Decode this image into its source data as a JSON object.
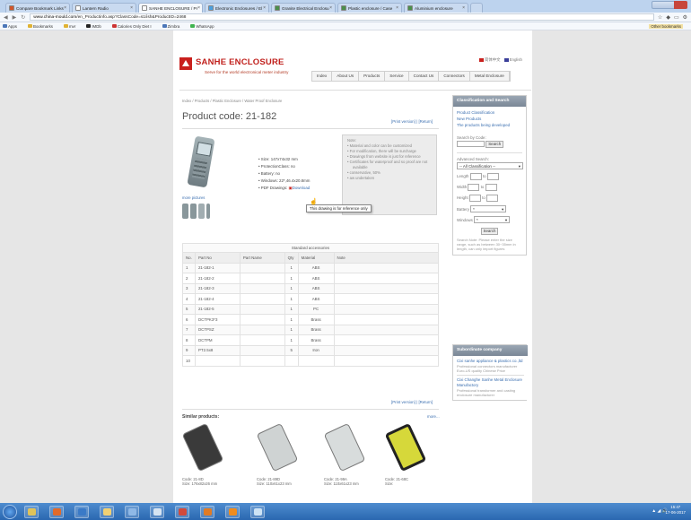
{
  "browser": {
    "tabs": [
      {
        "label": "Compare Bookmark Links",
        "color": "#d1552c"
      },
      {
        "label": "Lantern Radio",
        "color": "#ffffff"
      },
      {
        "label": "SANHE ENCLOSURE / Pr",
        "color": "#ffffff",
        "active": true
      },
      {
        "label": "Electronic Enclosures / El",
        "color": "#4aa0e0"
      },
      {
        "label": "Granite Electrical Enclosu",
        "color": "#4b8f4b"
      },
      {
        "label": "Plastic enclosure / Case",
        "color": "#4b8f4b"
      },
      {
        "label": "Aluminium enclosure",
        "color": "#4b8f4b"
      }
    ],
    "url_host": "www.china-mould.com",
    "url_path": "/en_Productinfo.asp?ClassCode=s1/ish&ProductID=2468",
    "bookmarks": [
      {
        "label": "Apps",
        "color": "#4b76b8"
      },
      {
        "label": "Bookmarks",
        "color": "#e0b233"
      },
      {
        "label": "mvr",
        "color": "#e0b233"
      },
      {
        "label": "IMDb",
        "color": "#222222"
      },
      {
        "label": "Calories Only Diet I",
        "color": "#cc3333"
      },
      {
        "label": "Zimbra",
        "color": "#4b76b8"
      },
      {
        "label": "WhatsApp",
        "color": "#3fb34f"
      }
    ],
    "other_bookmarks": "Other bookmarks"
  },
  "site": {
    "brand": "SANHE ENCLOSURE",
    "slogan": "Serve for the world electronical meter industry",
    "lang_cn": "简体中文",
    "lang_en": "English",
    "menu": [
      "Index",
      "About Us",
      "Products",
      "Service",
      "Contact Us",
      "Connectors",
      "Metal Enclosure"
    ]
  },
  "product": {
    "breadcrumb": "Index / Products / Plastic Enclosure / Water Proof Enclosure",
    "code_title": "Product code: 21-182",
    "print": "[Print version]",
    "return": "[Return]",
    "more_pictures": "more pictures",
    "specs": [
      "Size: 147x74x32 mm",
      "ProtectionClass: no",
      "Battery: no",
      "Windows: 22*,46.4x20.8mm"
    ],
    "pdf_label": "PDF Drawings:",
    "download": "Download",
    "tooltip": "This drawing is for reference only",
    "note_title": "Note:",
    "notes": [
      "Material and color can be customized",
      "For modification, there will be surcharge",
      "Drawings from website is just for reference",
      "Certificates for waterproof and so proof are not available",
      "conservative, 50%",
      "aw undertaken"
    ]
  },
  "accessories": {
    "caption": "Standard accessories",
    "headers": [
      "No.",
      "Part No",
      "Part Name",
      "Qty",
      "Material",
      "Note"
    ],
    "rows": [
      [
        "1",
        "21-182-1",
        "",
        "1",
        "ABS",
        ""
      ],
      [
        "2",
        "21-182-2",
        "",
        "1",
        "ABS",
        ""
      ],
      [
        "3",
        "21-182-3",
        "",
        "1",
        "ABS",
        ""
      ],
      [
        "4",
        "21-182-4",
        "",
        "1",
        "ABS",
        ""
      ],
      [
        "5",
        "21-182-5",
        "",
        "1",
        "PC",
        ""
      ],
      [
        "6",
        "DCTPK3*3",
        "",
        "1",
        "Brass",
        ""
      ],
      [
        "7",
        "DCTPSZ",
        "",
        "1",
        "Brass",
        ""
      ],
      [
        "8",
        "DCTPM",
        "",
        "1",
        "Brass",
        ""
      ],
      [
        "9",
        "PT2.5x8",
        "",
        "5",
        "Iron",
        ""
      ],
      [
        "10",
        "",
        "",
        "",
        "",
        ""
      ]
    ]
  },
  "similar": {
    "title": "Similar products:",
    "more": "more...",
    "items": [
      {
        "code": "Code: 21-8D",
        "size": "Size: 176x82x26 mm",
        "color": "#3a3a3a"
      },
      {
        "code": "Code: 21-89D",
        "size": "Size: 110x61x23 mm",
        "color": "#cfd3d3"
      },
      {
        "code": "Code: 21-99A",
        "size": "Size: 110x61x23 mm",
        "color": "#d8dcdc"
      },
      {
        "code": "Code: 21-68C",
        "size": "Size:",
        "color": "#d6d83a"
      }
    ]
  },
  "sidebar": {
    "title": "Classification and Search",
    "links": [
      "Product Classification",
      "New Products",
      "The products being developed"
    ],
    "search_code_label": "Search by Code:",
    "search_btn": "Search",
    "adv_title": "Advanced Search:",
    "all_class": "-- All Classification --",
    "length": "Length",
    "width": "Width",
    "height": "Height",
    "to": "to",
    "battery": "Battery",
    "windows": "Windows",
    "star": "*",
    "adv_btn": "Search",
    "hint": "Search Note: Please enter the size range, such as between 30~35mm in length, can only import figures"
  },
  "subordinate": {
    "title": "Subordinate company",
    "c1_name": "Cixi sanhe appliance & plastics co.,ltd",
    "c1_desc": "Professional connectors manufacturer",
    "c1_tag": "Euro-US quality Chinese Price",
    "c2_name": "Cixi Changhe Sanhe Metal Enclosure Manufactory",
    "c2_desc": "Professional transformer and casting enclosure manufacturer"
  },
  "taskbar": {
    "time": "15:47",
    "date": "17-06-2017",
    "apps": [
      {
        "name": "windows-explorer",
        "color": "#e0c35a"
      },
      {
        "name": "media-player",
        "color": "#e06a2b"
      },
      {
        "name": "office",
        "color": "#3a7ac7"
      },
      {
        "name": "folder",
        "color": "#f1d073"
      },
      {
        "name": "network",
        "color": "#8fb8e6"
      },
      {
        "name": "paint",
        "color": "#d6e4f2"
      },
      {
        "name": "chrome",
        "color": "#d24a3c"
      },
      {
        "name": "firefox",
        "color": "#e07b25"
      },
      {
        "name": "vlc",
        "color": "#f08c1e"
      },
      {
        "name": "snipping",
        "color": "#cde3f5"
      }
    ],
    "tray": "▲ ◢ 🔊"
  }
}
